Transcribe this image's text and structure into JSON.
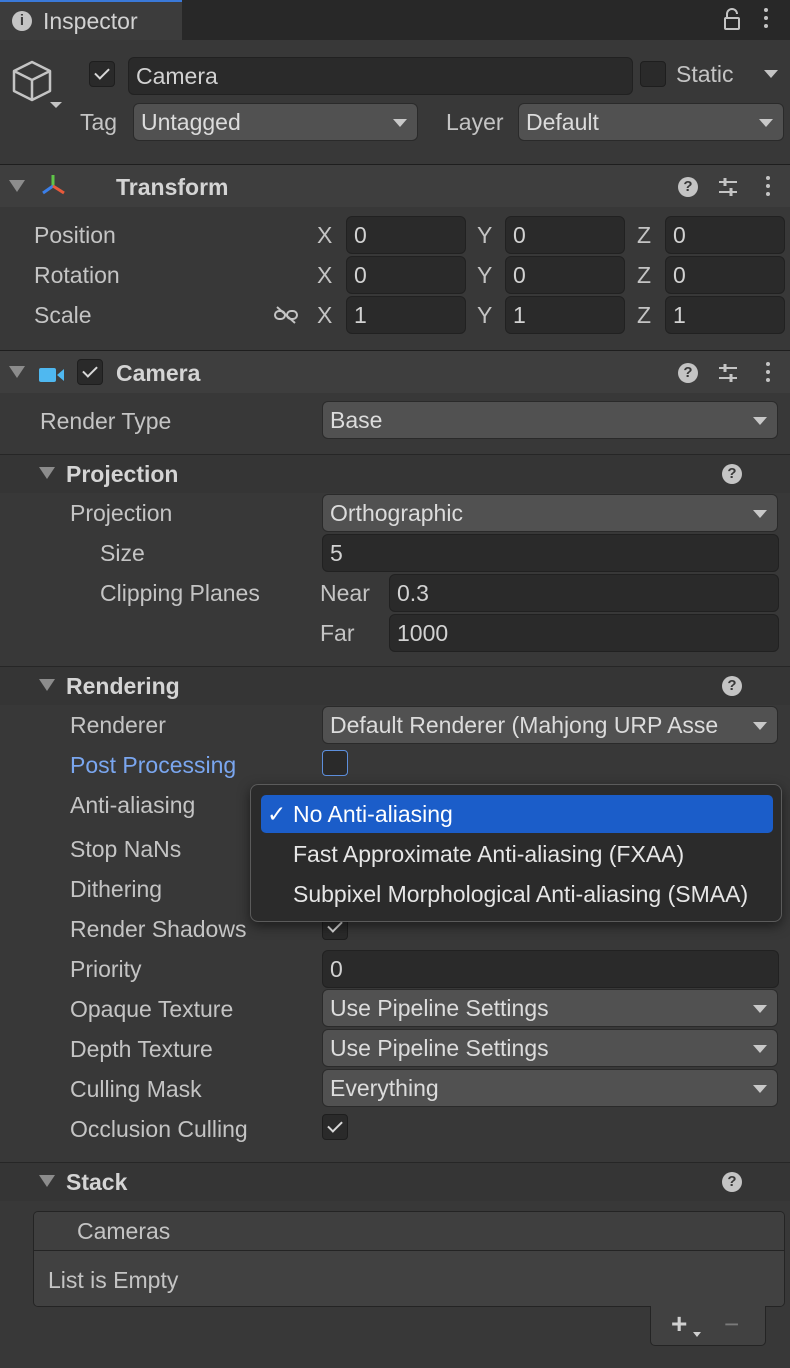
{
  "tab": {
    "title": "Inspector",
    "icon": "info-icon"
  },
  "object": {
    "name": "Camera",
    "static_label": "Static",
    "tag_label": "Tag",
    "tag_value": "Untagged",
    "layer_label": "Layer",
    "layer_value": "Default"
  },
  "transform": {
    "title": "Transform",
    "rows": [
      {
        "label": "Position",
        "x": "0",
        "y": "0",
        "z": "0"
      },
      {
        "label": "Rotation",
        "x": "0",
        "y": "0",
        "z": "0"
      },
      {
        "label": "Scale",
        "x": "1",
        "y": "1",
        "z": "1"
      }
    ],
    "axis": {
      "x": "X",
      "y": "Y",
      "z": "Z"
    }
  },
  "camera": {
    "title": "Camera",
    "render_type_label": "Render Type",
    "render_type_value": "Base"
  },
  "projection": {
    "title": "Projection",
    "projection_label": "Projection",
    "projection_value": "Orthographic",
    "size_label": "Size",
    "size_value": "5",
    "clipping_label": "Clipping Planes",
    "near_label": "Near",
    "near_value": "0.3",
    "far_label": "Far",
    "far_value": "1000"
  },
  "rendering": {
    "title": "Rendering",
    "renderer_label": "Renderer",
    "renderer_value": "Default Renderer (Mahjong URP Asse",
    "post_label": "Post Processing",
    "aa_label": "Anti-aliasing",
    "stop_nans_label": "Stop NaNs",
    "dithering_label": "Dithering",
    "shadows_label": "Render Shadows",
    "priority_label": "Priority",
    "priority_value": "0",
    "opaque_label": "Opaque Texture",
    "opaque_value": "Use Pipeline Settings",
    "depth_label": "Depth Texture",
    "depth_value": "Use Pipeline Settings",
    "culling_label": "Culling Mask",
    "culling_value": "Everything",
    "occlusion_label": "Occlusion Culling"
  },
  "aa_menu": {
    "items": [
      "No Anti-aliasing",
      "Fast Approximate Anti-aliasing (FXAA)",
      "Subpixel Morphological Anti-aliasing (SMAA)"
    ],
    "selected_mark": "✓"
  },
  "stack": {
    "title": "Stack",
    "list_header": "Cameras",
    "empty_text": "List is Empty",
    "add": "+",
    "remove": "−"
  },
  "colors": {
    "accent": "#1b5dc9",
    "link": "#7aa6ef",
    "background": "#383838"
  }
}
